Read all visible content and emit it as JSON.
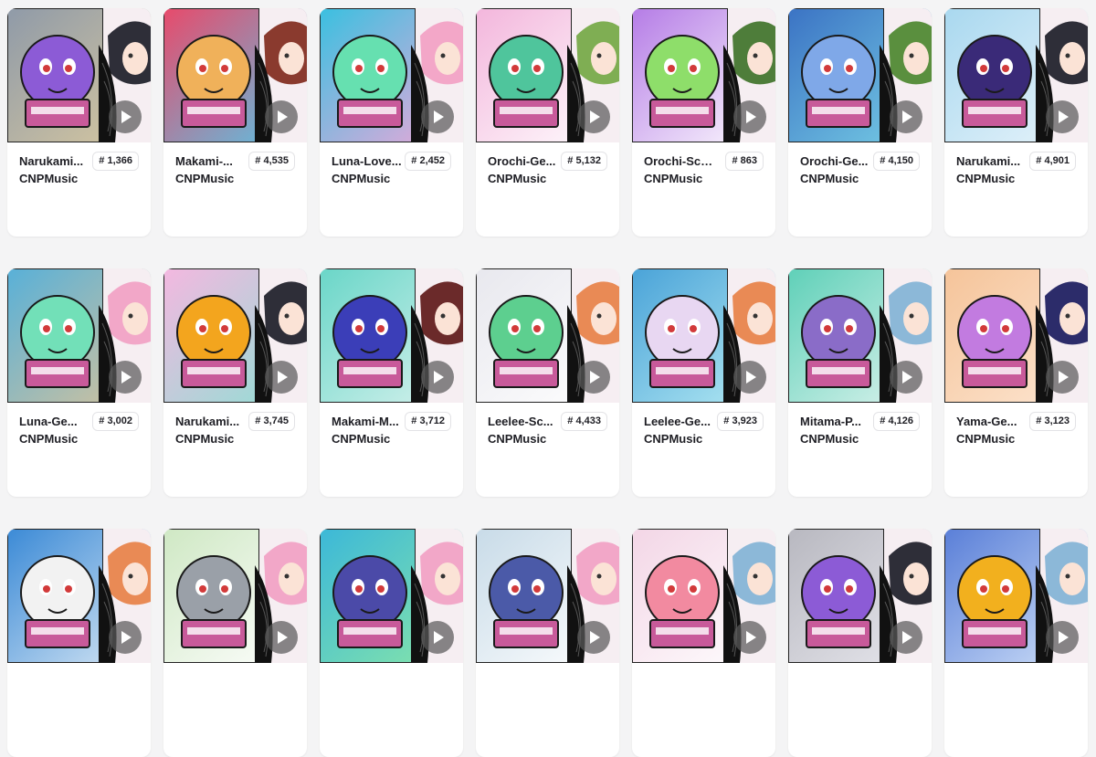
{
  "cards": [
    {
      "name": "Narukami...",
      "collection": "CNPMusic",
      "rank": "# 1,366",
      "bg1": "#8f9aa8",
      "bg2": "#d9c9a0",
      "char": "#8c5bd6",
      "hair": "#2e2e38",
      "inst": "violin-icon"
    },
    {
      "name": "Makami-...",
      "collection": "CNPMusic",
      "rank": "# 4,535",
      "bg1": "#e84a6b",
      "bg2": "#55c7e8",
      "char": "#f0b15a",
      "hair": "#8a3a2e",
      "inst": "piano-icon"
    },
    {
      "name": "Luna-Love...",
      "collection": "CNPMusic",
      "rank": "# 2,452",
      "bg1": "#3ac0e0",
      "bg2": "#f2a7d9",
      "char": "#66e0b0",
      "hair": "#f3a7c8",
      "inst": "violin-icon"
    },
    {
      "name": "Orochi-Ge...",
      "collection": "CNPMusic",
      "rank": "# 5,132",
      "bg1": "#f3b6dc",
      "bg2": "#ffffff",
      "char": "#4fc59c",
      "hair": "#7fae53",
      "inst": "keytar-icon"
    },
    {
      "name": "Orochi-Sco...",
      "collection": "CNPMusic",
      "rank": "# 863",
      "bg1": "#b57ce6",
      "bg2": "#ffffff",
      "char": "#8ede6a",
      "hair": "#4e7d3a",
      "inst": "guitar-icon"
    },
    {
      "name": "Orochi-Ge...",
      "collection": "CNPMusic",
      "rank": "# 4,150",
      "bg1": "#3b73c4",
      "bg2": "#78d0e6",
      "char": "#7fa8e8",
      "hair": "#5a8f3e",
      "inst": "piano-icon"
    },
    {
      "name": "Narukami...",
      "collection": "CNPMusic",
      "rank": "# 4,901",
      "bg1": "#a9d8ef",
      "bg2": "#e8f4fb",
      "char": "#3a2a78",
      "hair": "#2e2e38",
      "inst": "keytar-icon"
    },
    {
      "name": "Luna-Ge...",
      "collection": "CNPMusic",
      "rank": "# 3,002",
      "bg1": "#58b0d8",
      "bg2": "#d9c39a",
      "char": "#72e0b8",
      "hair": "#f2a7c8",
      "inst": "piano-icon"
    },
    {
      "name": "Narukami...",
      "collection": "CNPMusic",
      "rank": "# 3,745",
      "bg1": "#f4b8e0",
      "bg2": "#8ee0d4",
      "char": "#f3a51e",
      "hair": "#2e2e38",
      "inst": "guitar-icon"
    },
    {
      "name": "Makami-M...",
      "collection": "CNPMusic",
      "rank": "# 3,712",
      "bg1": "#6ad6c8",
      "bg2": "#d8f2ee",
      "char": "#3b3eb8",
      "hair": "#6b2a2a",
      "inst": "violin-icon"
    },
    {
      "name": "Leelee-Sc...",
      "collection": "CNPMusic",
      "rank": "# 4,433",
      "bg1": "#e8e8ee",
      "bg2": "#ffffff",
      "char": "#5dcf8f",
      "hair": "#e98a55",
      "inst": "keytar-icon"
    },
    {
      "name": "Leelee-Ge...",
      "collection": "CNPMusic",
      "rank": "# 3,923",
      "bg1": "#4aa3d8",
      "bg2": "#b7ecf4",
      "char": "#e8d7f2",
      "hair": "#e98a55",
      "inst": "guitar-icon"
    },
    {
      "name": "Mitama-P...",
      "collection": "CNPMusic",
      "rank": "# 4,126",
      "bg1": "#5fd0b8",
      "bg2": "#dff4ef",
      "char": "#8a6cc8",
      "hair": "#8cb8d8",
      "inst": "keytar-icon"
    },
    {
      "name": "Yama-Ge...",
      "collection": "CNPMusic",
      "rank": "# 3,123",
      "bg1": "#f5c49a",
      "bg2": "#fde6d2",
      "char": "#c27be0",
      "hair": "#2c2c6a",
      "inst": "violin-icon"
    },
    {
      "name": "",
      "collection": "",
      "rank": "",
      "bg1": "#3b8ad6",
      "bg2": "#dbe9f5",
      "char": "#f2f2f2",
      "hair": "#e98a55",
      "inst": "piano-icon"
    },
    {
      "name": "",
      "collection": "",
      "rank": "",
      "bg1": "#cfe8c4",
      "bg2": "#ffffff",
      "char": "#9aa0a8",
      "hair": "#f2a7c8",
      "inst": "saxophone-icon"
    },
    {
      "name": "",
      "collection": "",
      "rank": "",
      "bg1": "#3cb8d8",
      "bg2": "#88e6a8",
      "char": "#4b4aa8",
      "hair": "#f2a7c8",
      "inst": "piano-icon"
    },
    {
      "name": "",
      "collection": "",
      "rank": "",
      "bg1": "#c8dbe8",
      "bg2": "#ffffff",
      "char": "#4b5aa8",
      "hair": "#f2a7c8",
      "inst": "saxophone-icon"
    },
    {
      "name": "",
      "collection": "",
      "rank": "",
      "bg1": "#f3d6e6",
      "bg2": "#ffffff",
      "char": "#f28aa0",
      "hair": "#8cb8d8",
      "inst": "keytar-icon"
    },
    {
      "name": "",
      "collection": "",
      "rank": "",
      "bg1": "#b8b8c0",
      "bg2": "#e8e8ee",
      "char": "#8c5bd6",
      "hair": "#2e2e38",
      "inst": "violin-icon"
    },
    {
      "name": "",
      "collection": "",
      "rank": "",
      "bg1": "#5a7fd8",
      "bg2": "#cfe0f8",
      "char": "#f2b01e",
      "hair": "#8cb8d8",
      "inst": "guitar-icon"
    }
  ]
}
